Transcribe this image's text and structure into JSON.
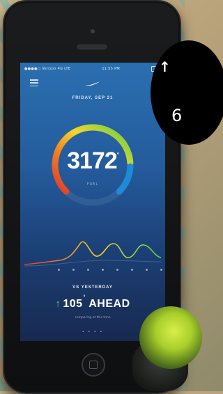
{
  "screen": {
    "status_bar": {
      "carrier": "●●●●○ Verizon 4G LTE",
      "time": "11:55 PM"
    },
    "date": "FRIDAY, SEP 21",
    "fuel": {
      "value": "3172",
      "unit": "FUEL",
      "ring_fraction": 0.82
    },
    "comparison": {
      "label": "VS YESTERDAY",
      "arrow": "↑",
      "value": "105",
      "suffix": "AHEAD",
      "caption": "comparing at this time"
    },
    "page_indicator": "• • • •"
  },
  "overlay": {
    "arrow": "↑",
    "digit": "6"
  },
  "colors": {
    "ring_red": "#e2352b",
    "ring_orange": "#f08a1f",
    "ring_yellow": "#f4d72a",
    "ring_green": "#5ccf4a",
    "ring_blue": "#1f8bd6",
    "ahead_arrow": "#55d06a"
  }
}
